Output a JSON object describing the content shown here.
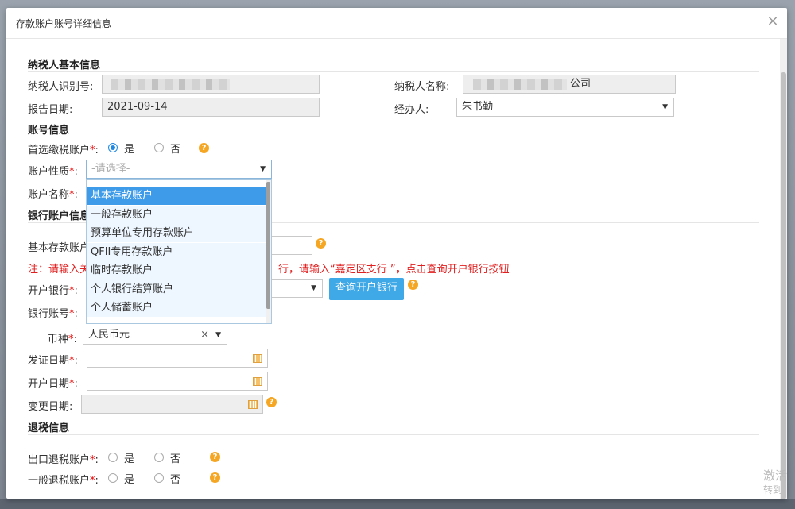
{
  "dialog": {
    "title": "存款账户账号详细信息",
    "close": "×"
  },
  "taxpayer_section": {
    "title": "纳税人基本信息",
    "id_label": "纳税人识别号:",
    "name_label": "纳税人名称:",
    "name_suffix": "公司",
    "report_date_label": "报告日期:",
    "report_date": "2021-09-14",
    "handler_label": "经办人:",
    "handler": "朱书勤"
  },
  "account_section": {
    "title": "账号信息",
    "preferred_label": "首选缴税账户",
    "yes": "是",
    "no": "否",
    "nature_label": "账户性质",
    "nature_placeholder": "-请选择-",
    "name_label": "账户名称"
  },
  "bank_section": {
    "title": "银行账户信息",
    "basic_label": "基本存款账户",
    "note_prefix": "注：请输入关",
    "note_suffix": "行，请输入“嘉定区支行 ”，点击查询开户银行按钮",
    "bank_label": "开户银行",
    "query_button": "查询开户银行",
    "account_no_label": "银行账号",
    "currency_label": "币种",
    "currency": "人民币元",
    "issue_date_label": "发证日期",
    "open_date_label": "开户日期",
    "change_date_label": "变更日期:"
  },
  "refund_section": {
    "title": "退税信息",
    "export_label": "出口退税账户",
    "general_label": "一般退税账户",
    "yes": "是",
    "no": "否"
  },
  "required_mark": "*",
  "colon": ":",
  "help": "?",
  "dropdown": {
    "items": [
      "基本存款账户",
      "一般存款账户",
      "预算单位专用存款账户",
      "QFII专用存款账户",
      "临时存款账户",
      "个人银行结算账户",
      "个人储蓄账户"
    ],
    "selected_index": 0
  },
  "watermark": {
    "line1": "激活",
    "line2": "转到"
  }
}
